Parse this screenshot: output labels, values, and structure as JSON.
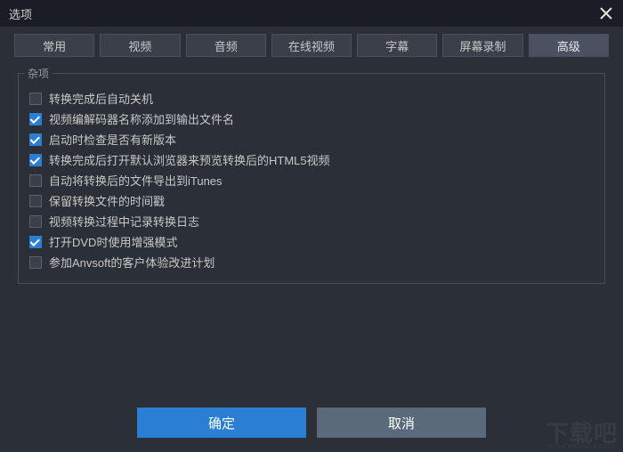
{
  "window": {
    "title": "选项"
  },
  "tabs": [
    {
      "label": "常用"
    },
    {
      "label": "视频"
    },
    {
      "label": "音频"
    },
    {
      "label": "在线视频"
    },
    {
      "label": "字幕"
    },
    {
      "label": "屏幕录制"
    },
    {
      "label": "高级",
      "active": true
    }
  ],
  "misc": {
    "legend": "杂项",
    "items": [
      {
        "label": "转换完成后自动关机",
        "checked": false
      },
      {
        "label": "视频编解码器名称添加到输出文件名",
        "checked": true
      },
      {
        "label": "启动时检查是否有新版本",
        "checked": true
      },
      {
        "label": "转换完成后打开默认浏览器来预览转换后的HTML5视频",
        "checked": true
      },
      {
        "label": "自动将转换后的文件导出到iTunes",
        "checked": false
      },
      {
        "label": "保留转换文件的时间戳",
        "checked": false
      },
      {
        "label": "视频转换过程中记录转换日志",
        "checked": false
      },
      {
        "label": "打开DVD时使用增强模式",
        "checked": true
      },
      {
        "label": "参加Anvsoft的客户体验改进计划",
        "checked": false
      }
    ]
  },
  "buttons": {
    "ok": "确定",
    "cancel": "取消"
  },
  "watermark": {
    "main": "下载吧",
    "sub": "www.xiazaiba.com"
  }
}
